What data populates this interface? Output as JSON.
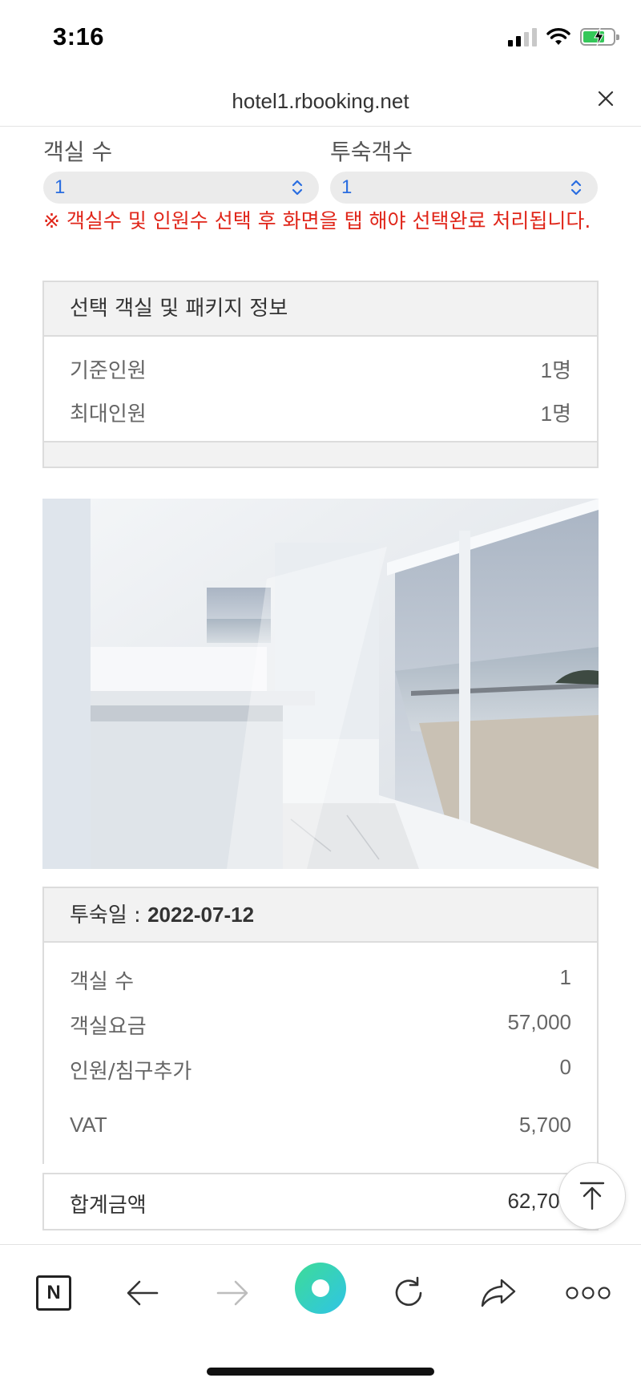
{
  "status_bar": {
    "time": "3:16"
  },
  "browser": {
    "url": "hotel1.rbooking.net"
  },
  "form": {
    "room_count_label": "객실 수",
    "room_count_value": "1",
    "guest_count_label": "투숙객수",
    "guest_count_value": "1",
    "notice": "※ 객실수 및 인원수 선택 후 화면을 탭 해야 선택완료 처리됩니다."
  },
  "room_info": {
    "title": "선택 객실 및 패키지 정보",
    "rows": [
      {
        "label": "기준인원",
        "value": "1명"
      },
      {
        "label": "최대인원",
        "value": "1명"
      }
    ]
  },
  "summary": {
    "date_label": "투숙일 : ",
    "date_value": "2022-07-12",
    "rows": [
      {
        "label": "객실 수",
        "value": "1"
      },
      {
        "label": "객실요금",
        "value": "57,000"
      },
      {
        "label": "인원/침구추가",
        "value": "0"
      },
      {
        "label": "VAT",
        "value": "5,700"
      }
    ],
    "total_label": "합계금액",
    "total_value": "62,700"
  },
  "toolbar": {
    "naver_letter": "N"
  },
  "colors": {
    "notice": "#e0261a",
    "select_text": "#2a6de0",
    "battery": "#34c759",
    "home_button_gradient": [
      "#3ddc97",
      "#2fc4e6"
    ]
  }
}
